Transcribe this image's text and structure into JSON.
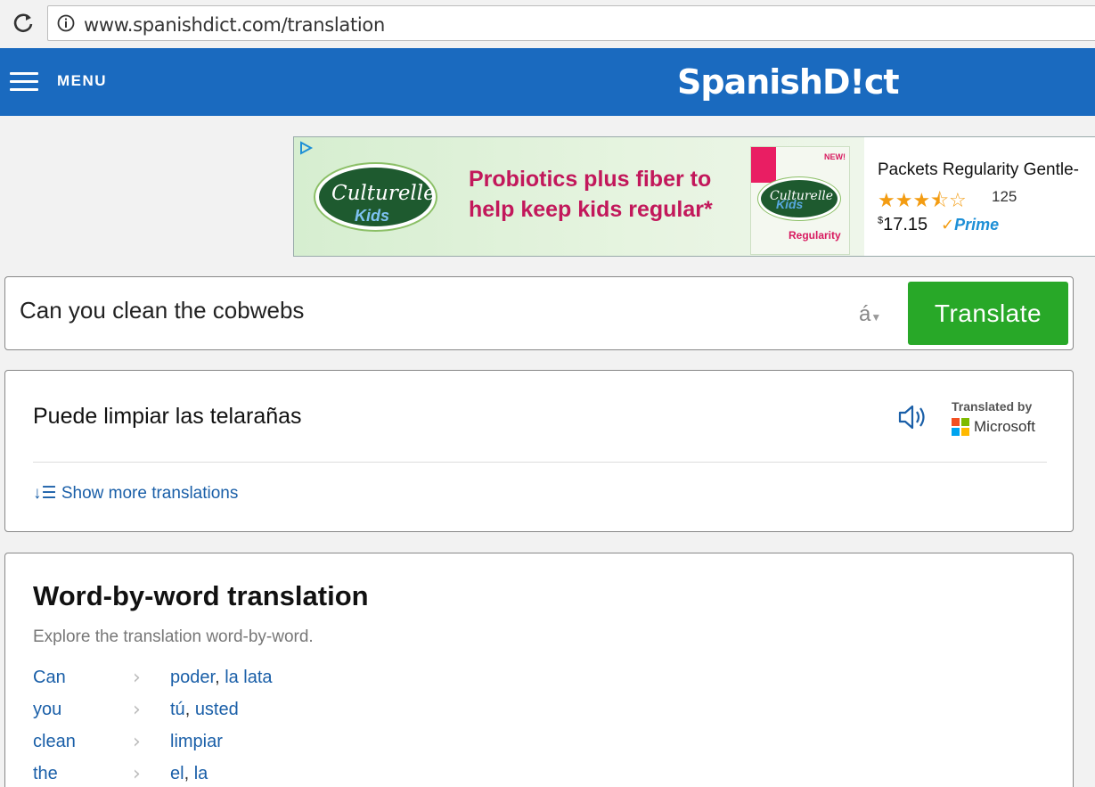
{
  "browser": {
    "url": "www.spanishdict.com/translation",
    "reload_icon": "reload-icon",
    "info_icon": "info-icon"
  },
  "header": {
    "menu_label": "MENU",
    "logo": "SpanishD!ct",
    "background": "#1a6abf"
  },
  "ad": {
    "brand": "Culturelle",
    "brand_sub": "Kids",
    "slogan": "Probiotics plus fiber to help keep kids regular*",
    "box_badge": "NEW!",
    "box_variant": "Regularity",
    "product_title": "Packets Regularity Gentle-",
    "rating": 3.5,
    "rating_max": 5,
    "stars": "★★★⯪☆",
    "review_count": "125",
    "price_symbol": "$",
    "price": "17.15",
    "prime_label": "Prime"
  },
  "input": {
    "value": "Can you clean the cobwebs",
    "accent_label": "á",
    "translate_button": "Translate"
  },
  "translation": {
    "text": "Puede limpiar las telarañas",
    "translated_by": "Translated by",
    "provider": "Microsoft",
    "more_label": "Show more translations"
  },
  "word_by_word": {
    "title": "Word-by-word translation",
    "subtitle": "Explore the translation word-by-word.",
    "rows": [
      {
        "source": "Can",
        "translations": [
          "poder",
          "la lata"
        ]
      },
      {
        "source": "you",
        "translations": [
          "tú",
          "usted"
        ]
      },
      {
        "source": "clean",
        "translations": [
          "limpiar"
        ]
      },
      {
        "source": "the",
        "translations": [
          "el",
          "la"
        ]
      }
    ]
  },
  "colors": {
    "accent_blue": "#1a6abf",
    "link_blue": "#1a5fa8",
    "button_green": "#28a828"
  }
}
